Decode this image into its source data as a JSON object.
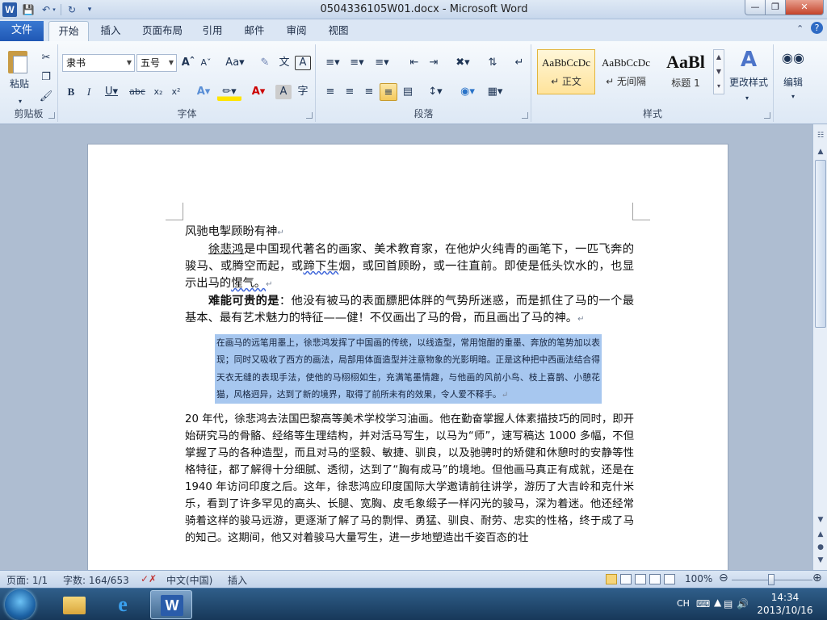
{
  "window": {
    "title": "0504336105W01.docx  -  Microsoft Word",
    "app_icon_letter": "W",
    "controls": {
      "minimize": "—",
      "maximize": "❐",
      "close": "✕"
    }
  },
  "ribbon_tabs": [
    "文件",
    "开始",
    "插入",
    "页面布局",
    "引用",
    "邮件",
    "审阅",
    "视图"
  ],
  "active_tab": "开始",
  "clipboard": {
    "paste": "粘贴",
    "group": "剪贴板"
  },
  "font": {
    "name": "隶书",
    "size": "五号",
    "group": "字体"
  },
  "paragraph": {
    "group": "段落"
  },
  "styles": {
    "group": "样式",
    "items": [
      {
        "preview": "AaBbCcDc",
        "name": "↵ 正文",
        "selected": true
      },
      {
        "preview": "AaBbCcDc",
        "name": "↵ 无间隔",
        "selected": false
      },
      {
        "preview": "AaBl",
        "name": "标题 1",
        "selected": false
      }
    ],
    "change_styles": "更改样式"
  },
  "editing": {
    "label": "编辑"
  },
  "document": {
    "title_line": "风驰电掣顾盼有神",
    "para1": {
      "name": "徐悲鸿",
      "text1": "是中国现代著名的画家、美术教育家，在他炉火纯青的画笔下，一匹飞奔的骏马、或腾空而起，或",
      "wavy": "蹄下生",
      "text2": "烟，或回首顾盼，或一往直前。即使是低头饮水的，也显示出马的",
      "tail": "惺气。"
    },
    "para2": {
      "bold": "难能可贵的是",
      "text": "：他没有被马的表面膘肥体胖的气势所迷惑，而是抓住了马的一个最基本、最有艺术魅力的特征——健！不仅画出了马的骨，而且画出了马的神。"
    },
    "quote": "在画马的远笔用墨上，徐悲鸿发挥了中国画的传统，以线造型，常用饱酣的重墨、奔放的笔势加以表现；同时又吸收了西方的画法，局部用体面造型并注意物象的光影明暗。正是这种把中西画法结合得天衣无缝的表现手法，使他的马栩栩如生，充满笔墨情趣，与他画的风前小鸟、枝上喜鹊、小憩花猫，风格迥异，达到了新的境界，取得了前所未有的效果，令人爱不释手。",
    "para4": "20 年代，徐悲鸿去法国巴黎高等美术学校学习油画。他在勤奋掌握人体素描技巧的同时，即开始研究马的骨骼、经络等生理结构，并对活马写生，以马为“师”，速写稿达 1000 多幅，不但掌握了马的各种造型，而且对马的坚毅、敏捷、驯良，以及驰骋时的矫健和休憩时的安静等性格特征，都了解得十分细腻、透彻，达到了“胸有成马”的境地。但他画马真正有成就，还是在 1940 年访问印度之后。这年，徐悲鸿应印度国际大学邀请前往讲学，游历了大吉岭和克什米乐，看到了许多罕见的高头、长腿、宽胸、皮毛象缎子一样闪光的骏马，深为着迷。他还经常骑着这样的骏马远游，更逐渐了解了马的剽悍、勇猛、驯良、耐劳、忠实的性格，终于成了马的知己。这期间，他又对着骏马大量写生，进一步地塑造出千姿百态的壮"
  },
  "statusbar": {
    "page": "页面: 1/1",
    "words": "字数: 164/653",
    "language": "中文(中国)",
    "mode": "插入",
    "zoom": "100%",
    "zoom_fraction": 0.5
  },
  "taskbar": {
    "ime": "CH",
    "time": "14:34",
    "date": "2013/10/16"
  },
  "colors": {
    "selection": "#a7c7ef",
    "file_tab": "#2a62bf",
    "taskbar": "#1f4a72"
  }
}
